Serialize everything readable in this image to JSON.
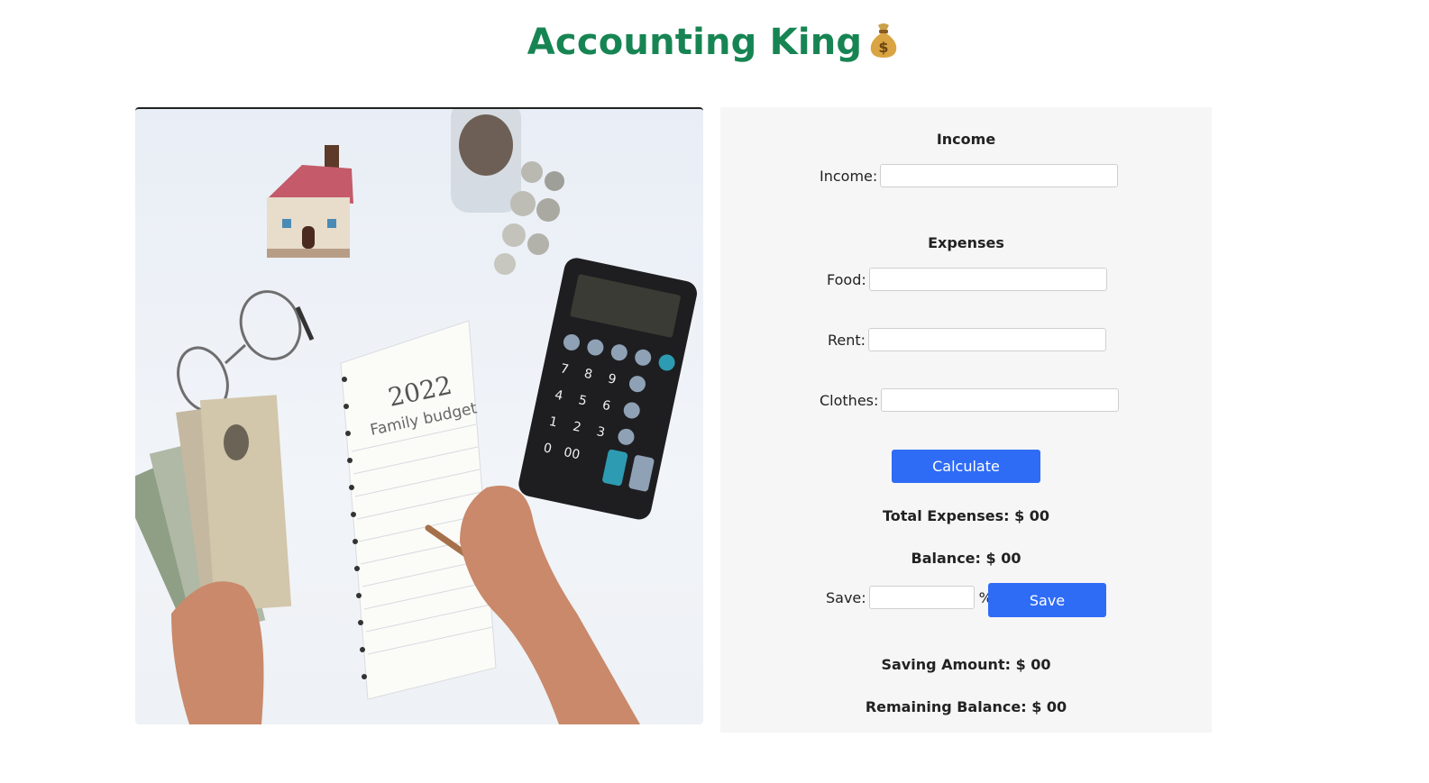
{
  "header": {
    "title": "Accounting King",
    "emoji_icon": "money-bag-icon"
  },
  "illustration": {
    "notebook_year": "2022",
    "notebook_caption": "Family budget"
  },
  "income_section": {
    "heading": "Income",
    "income_label": "Income:",
    "income_value": ""
  },
  "expenses_section": {
    "heading": "Expenses",
    "food_label": "Food:",
    "food_value": "",
    "rent_label": "Rent:",
    "rent_value": "",
    "clothes_label": "Clothes:",
    "clothes_value": ""
  },
  "actions": {
    "calculate_label": "Calculate",
    "save_label": "Save"
  },
  "results": {
    "total_expenses": "Total Expenses: $ 00",
    "balance": "Balance: $ 00",
    "saving_amount": "Saving Amount: $ 00",
    "remaining_balance": "Remaining Balance: $ 00"
  },
  "save_row": {
    "label": "Save:",
    "value": "",
    "unit": "%"
  },
  "colors": {
    "title": "#178553",
    "button": "#2f6cf6",
    "panel_bg": "#f6f6f6"
  }
}
